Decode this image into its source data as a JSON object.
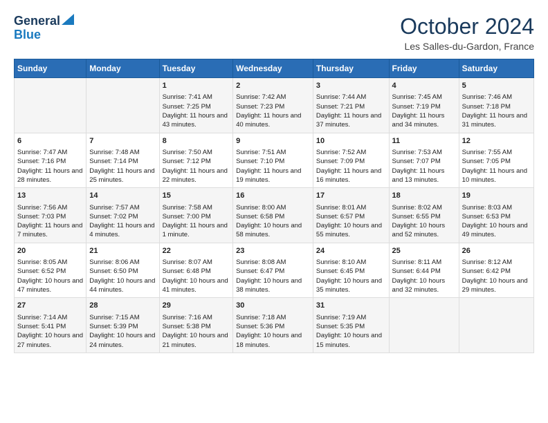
{
  "header": {
    "logo_general": "General",
    "logo_blue": "Blue",
    "month_title": "October 2024",
    "location": "Les Salles-du-Gardon, France"
  },
  "days_of_week": [
    "Sunday",
    "Monday",
    "Tuesday",
    "Wednesday",
    "Thursday",
    "Friday",
    "Saturday"
  ],
  "weeks": [
    [
      {
        "day": "",
        "sunrise": "",
        "sunset": "",
        "daylight": ""
      },
      {
        "day": "",
        "sunrise": "",
        "sunset": "",
        "daylight": ""
      },
      {
        "day": "1",
        "sunrise": "Sunrise: 7:41 AM",
        "sunset": "Sunset: 7:25 PM",
        "daylight": "Daylight: 11 hours and 43 minutes."
      },
      {
        "day": "2",
        "sunrise": "Sunrise: 7:42 AM",
        "sunset": "Sunset: 7:23 PM",
        "daylight": "Daylight: 11 hours and 40 minutes."
      },
      {
        "day": "3",
        "sunrise": "Sunrise: 7:44 AM",
        "sunset": "Sunset: 7:21 PM",
        "daylight": "Daylight: 11 hours and 37 minutes."
      },
      {
        "day": "4",
        "sunrise": "Sunrise: 7:45 AM",
        "sunset": "Sunset: 7:19 PM",
        "daylight": "Daylight: 11 hours and 34 minutes."
      },
      {
        "day": "5",
        "sunrise": "Sunrise: 7:46 AM",
        "sunset": "Sunset: 7:18 PM",
        "daylight": "Daylight: 11 hours and 31 minutes."
      }
    ],
    [
      {
        "day": "6",
        "sunrise": "Sunrise: 7:47 AM",
        "sunset": "Sunset: 7:16 PM",
        "daylight": "Daylight: 11 hours and 28 minutes."
      },
      {
        "day": "7",
        "sunrise": "Sunrise: 7:48 AM",
        "sunset": "Sunset: 7:14 PM",
        "daylight": "Daylight: 11 hours and 25 minutes."
      },
      {
        "day": "8",
        "sunrise": "Sunrise: 7:50 AM",
        "sunset": "Sunset: 7:12 PM",
        "daylight": "Daylight: 11 hours and 22 minutes."
      },
      {
        "day": "9",
        "sunrise": "Sunrise: 7:51 AM",
        "sunset": "Sunset: 7:10 PM",
        "daylight": "Daylight: 11 hours and 19 minutes."
      },
      {
        "day": "10",
        "sunrise": "Sunrise: 7:52 AM",
        "sunset": "Sunset: 7:09 PM",
        "daylight": "Daylight: 11 hours and 16 minutes."
      },
      {
        "day": "11",
        "sunrise": "Sunrise: 7:53 AM",
        "sunset": "Sunset: 7:07 PM",
        "daylight": "Daylight: 11 hours and 13 minutes."
      },
      {
        "day": "12",
        "sunrise": "Sunrise: 7:55 AM",
        "sunset": "Sunset: 7:05 PM",
        "daylight": "Daylight: 11 hours and 10 minutes."
      }
    ],
    [
      {
        "day": "13",
        "sunrise": "Sunrise: 7:56 AM",
        "sunset": "Sunset: 7:03 PM",
        "daylight": "Daylight: 11 hours and 7 minutes."
      },
      {
        "day": "14",
        "sunrise": "Sunrise: 7:57 AM",
        "sunset": "Sunset: 7:02 PM",
        "daylight": "Daylight: 11 hours and 4 minutes."
      },
      {
        "day": "15",
        "sunrise": "Sunrise: 7:58 AM",
        "sunset": "Sunset: 7:00 PM",
        "daylight": "Daylight: 11 hours and 1 minute."
      },
      {
        "day": "16",
        "sunrise": "Sunrise: 8:00 AM",
        "sunset": "Sunset: 6:58 PM",
        "daylight": "Daylight: 10 hours and 58 minutes."
      },
      {
        "day": "17",
        "sunrise": "Sunrise: 8:01 AM",
        "sunset": "Sunset: 6:57 PM",
        "daylight": "Daylight: 10 hours and 55 minutes."
      },
      {
        "day": "18",
        "sunrise": "Sunrise: 8:02 AM",
        "sunset": "Sunset: 6:55 PM",
        "daylight": "Daylight: 10 hours and 52 minutes."
      },
      {
        "day": "19",
        "sunrise": "Sunrise: 8:03 AM",
        "sunset": "Sunset: 6:53 PM",
        "daylight": "Daylight: 10 hours and 49 minutes."
      }
    ],
    [
      {
        "day": "20",
        "sunrise": "Sunrise: 8:05 AM",
        "sunset": "Sunset: 6:52 PM",
        "daylight": "Daylight: 10 hours and 47 minutes."
      },
      {
        "day": "21",
        "sunrise": "Sunrise: 8:06 AM",
        "sunset": "Sunset: 6:50 PM",
        "daylight": "Daylight: 10 hours and 44 minutes."
      },
      {
        "day": "22",
        "sunrise": "Sunrise: 8:07 AM",
        "sunset": "Sunset: 6:48 PM",
        "daylight": "Daylight: 10 hours and 41 minutes."
      },
      {
        "day": "23",
        "sunrise": "Sunrise: 8:08 AM",
        "sunset": "Sunset: 6:47 PM",
        "daylight": "Daylight: 10 hours and 38 minutes."
      },
      {
        "day": "24",
        "sunrise": "Sunrise: 8:10 AM",
        "sunset": "Sunset: 6:45 PM",
        "daylight": "Daylight: 10 hours and 35 minutes."
      },
      {
        "day": "25",
        "sunrise": "Sunrise: 8:11 AM",
        "sunset": "Sunset: 6:44 PM",
        "daylight": "Daylight: 10 hours and 32 minutes."
      },
      {
        "day": "26",
        "sunrise": "Sunrise: 8:12 AM",
        "sunset": "Sunset: 6:42 PM",
        "daylight": "Daylight: 10 hours and 29 minutes."
      }
    ],
    [
      {
        "day": "27",
        "sunrise": "Sunrise: 7:14 AM",
        "sunset": "Sunset: 5:41 PM",
        "daylight": "Daylight: 10 hours and 27 minutes."
      },
      {
        "day": "28",
        "sunrise": "Sunrise: 7:15 AM",
        "sunset": "Sunset: 5:39 PM",
        "daylight": "Daylight: 10 hours and 24 minutes."
      },
      {
        "day": "29",
        "sunrise": "Sunrise: 7:16 AM",
        "sunset": "Sunset: 5:38 PM",
        "daylight": "Daylight: 10 hours and 21 minutes."
      },
      {
        "day": "30",
        "sunrise": "Sunrise: 7:18 AM",
        "sunset": "Sunset: 5:36 PM",
        "daylight": "Daylight: 10 hours and 18 minutes."
      },
      {
        "day": "31",
        "sunrise": "Sunrise: 7:19 AM",
        "sunset": "Sunset: 5:35 PM",
        "daylight": "Daylight: 10 hours and 15 minutes."
      },
      {
        "day": "",
        "sunrise": "",
        "sunset": "",
        "daylight": ""
      },
      {
        "day": "",
        "sunrise": "",
        "sunset": "",
        "daylight": ""
      }
    ]
  ]
}
